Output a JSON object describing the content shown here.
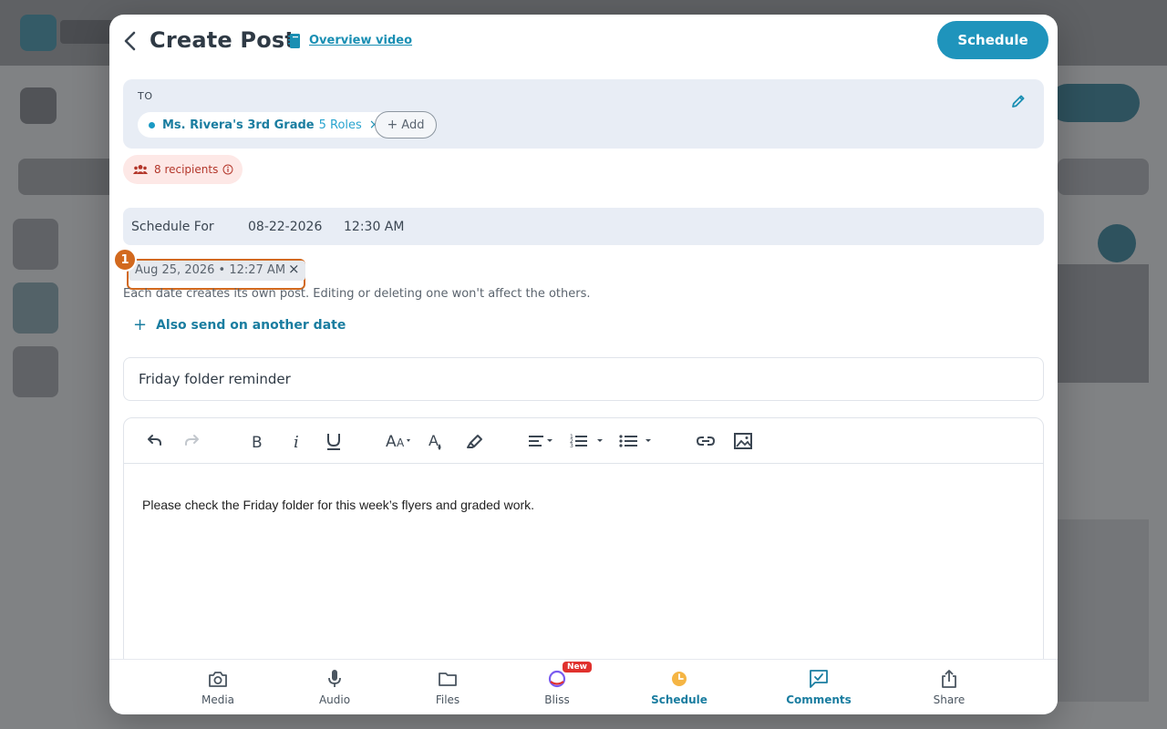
{
  "modal": {
    "title": "Create Post",
    "video_link": "Overview video",
    "schedule_button": "Schedule"
  },
  "to": {
    "label": "TO",
    "chip_name": "Ms. Rivera's 3rd Grade",
    "chip_roles": "5 Roles",
    "chip_remove": "×",
    "add_label": "Add"
  },
  "recipients": {
    "text": "8 recipients"
  },
  "schedule": {
    "label": "Schedule For",
    "date": "08-22-2026",
    "time": "12:30 AM",
    "extra_date": "Aug 25, 2026 • 12:27 AM",
    "extra_remove": "×",
    "marker": "1",
    "helper": "Each date creates its own post. Editing or deleting one won't affect the others.",
    "also_send": "Also send on another date"
  },
  "subject": {
    "value": "Friday folder reminder"
  },
  "editor": {
    "body": "Please check the Friday folder for this week’s flyers and graded work."
  },
  "bottom_bar": {
    "items": [
      {
        "label": "Media",
        "icon": "camera-icon"
      },
      {
        "label": "Audio",
        "icon": "microphone-icon"
      },
      {
        "label": "Files",
        "icon": "folder-icon"
      },
      {
        "label": "Bliss",
        "icon": "bliss-icon",
        "badge": "New"
      },
      {
        "label": "Schedule",
        "icon": "clock-icon"
      },
      {
        "label": "Comments",
        "icon": "comments-icon"
      },
      {
        "label": "Share",
        "icon": "share-icon"
      }
    ]
  },
  "colors": {
    "accent": "#1f94bc",
    "highlight": "#d2691e",
    "badge_red": "#e0312d",
    "recipients_bg": "#fde8e6"
  }
}
